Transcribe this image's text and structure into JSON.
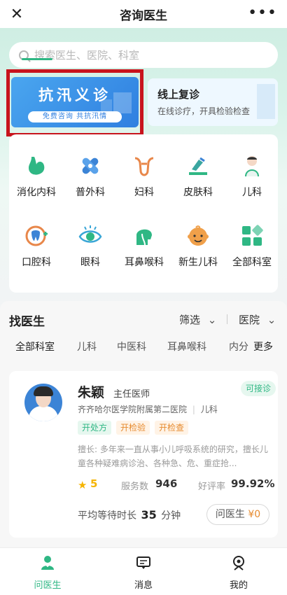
{
  "topbar": {
    "title": "咨询医生",
    "close_icon": "close-icon",
    "more_icon": "more-icon"
  },
  "search": {
    "placeholder": "搜索医生、医院、科室"
  },
  "promo": {
    "title": "抗汛义诊",
    "subtitle": "免费咨询 共抗汛情"
  },
  "online": {
    "title": "线上复诊",
    "subtitle": "在线诊疗，开具检验检查"
  },
  "departments": [
    {
      "label": "消化内科",
      "icon": "stomach-icon"
    },
    {
      "label": "普外科",
      "icon": "bandage-icon"
    },
    {
      "label": "妇科",
      "icon": "uterus-icon"
    },
    {
      "label": "皮肤科",
      "icon": "dermatology-icon"
    },
    {
      "label": "儿科",
      "icon": "child-icon"
    },
    {
      "label": "口腔科",
      "icon": "tooth-icon"
    },
    {
      "label": "眼科",
      "icon": "eye-icon"
    },
    {
      "label": "耳鼻喉科",
      "icon": "ent-icon"
    },
    {
      "label": "新生儿科",
      "icon": "baby-icon"
    },
    {
      "label": "全部科室",
      "icon": "grid-icon"
    }
  ],
  "find_doctor": {
    "title": "找医生",
    "filter_label": "筛选",
    "hospital_label": "医院",
    "tabs": [
      "全部科室",
      "儿科",
      "中医科",
      "耳鼻喉科",
      "内分",
      "更多"
    ]
  },
  "doctor": {
    "name": "朱颖",
    "title": "主任医师",
    "status": "可接诊",
    "hospital": "齐齐哈尔医学院附属第二医院",
    "department": "儿科",
    "tags": [
      "开处方",
      "开检验",
      "开检查"
    ],
    "description": "擅长: 多年来一直从事小儿呼吸系统的研究，擅长儿童各种疑难病诊治、各种急、危、重症抢...",
    "rating": "5",
    "service_label": "服务数",
    "service_count": "946",
    "praise_label": "好评率",
    "praise_rate": "99.92%",
    "wait_label_pre": "平均等待时长",
    "wait_value": "35",
    "wait_label_post": "分钟",
    "ask_label": "问医生",
    "ask_price": "¥0"
  },
  "bottom_nav": [
    {
      "label": "问医生",
      "icon": "doctor-icon",
      "active": true
    },
    {
      "label": "消息",
      "icon": "message-icon",
      "active": false
    },
    {
      "label": "我的",
      "icon": "profile-icon",
      "active": false
    }
  ],
  "colors": {
    "accent": "#2fb784",
    "promo_blue": "#2f7fe0",
    "highlight_red": "#c8141d",
    "orange": "#e68a2e"
  }
}
